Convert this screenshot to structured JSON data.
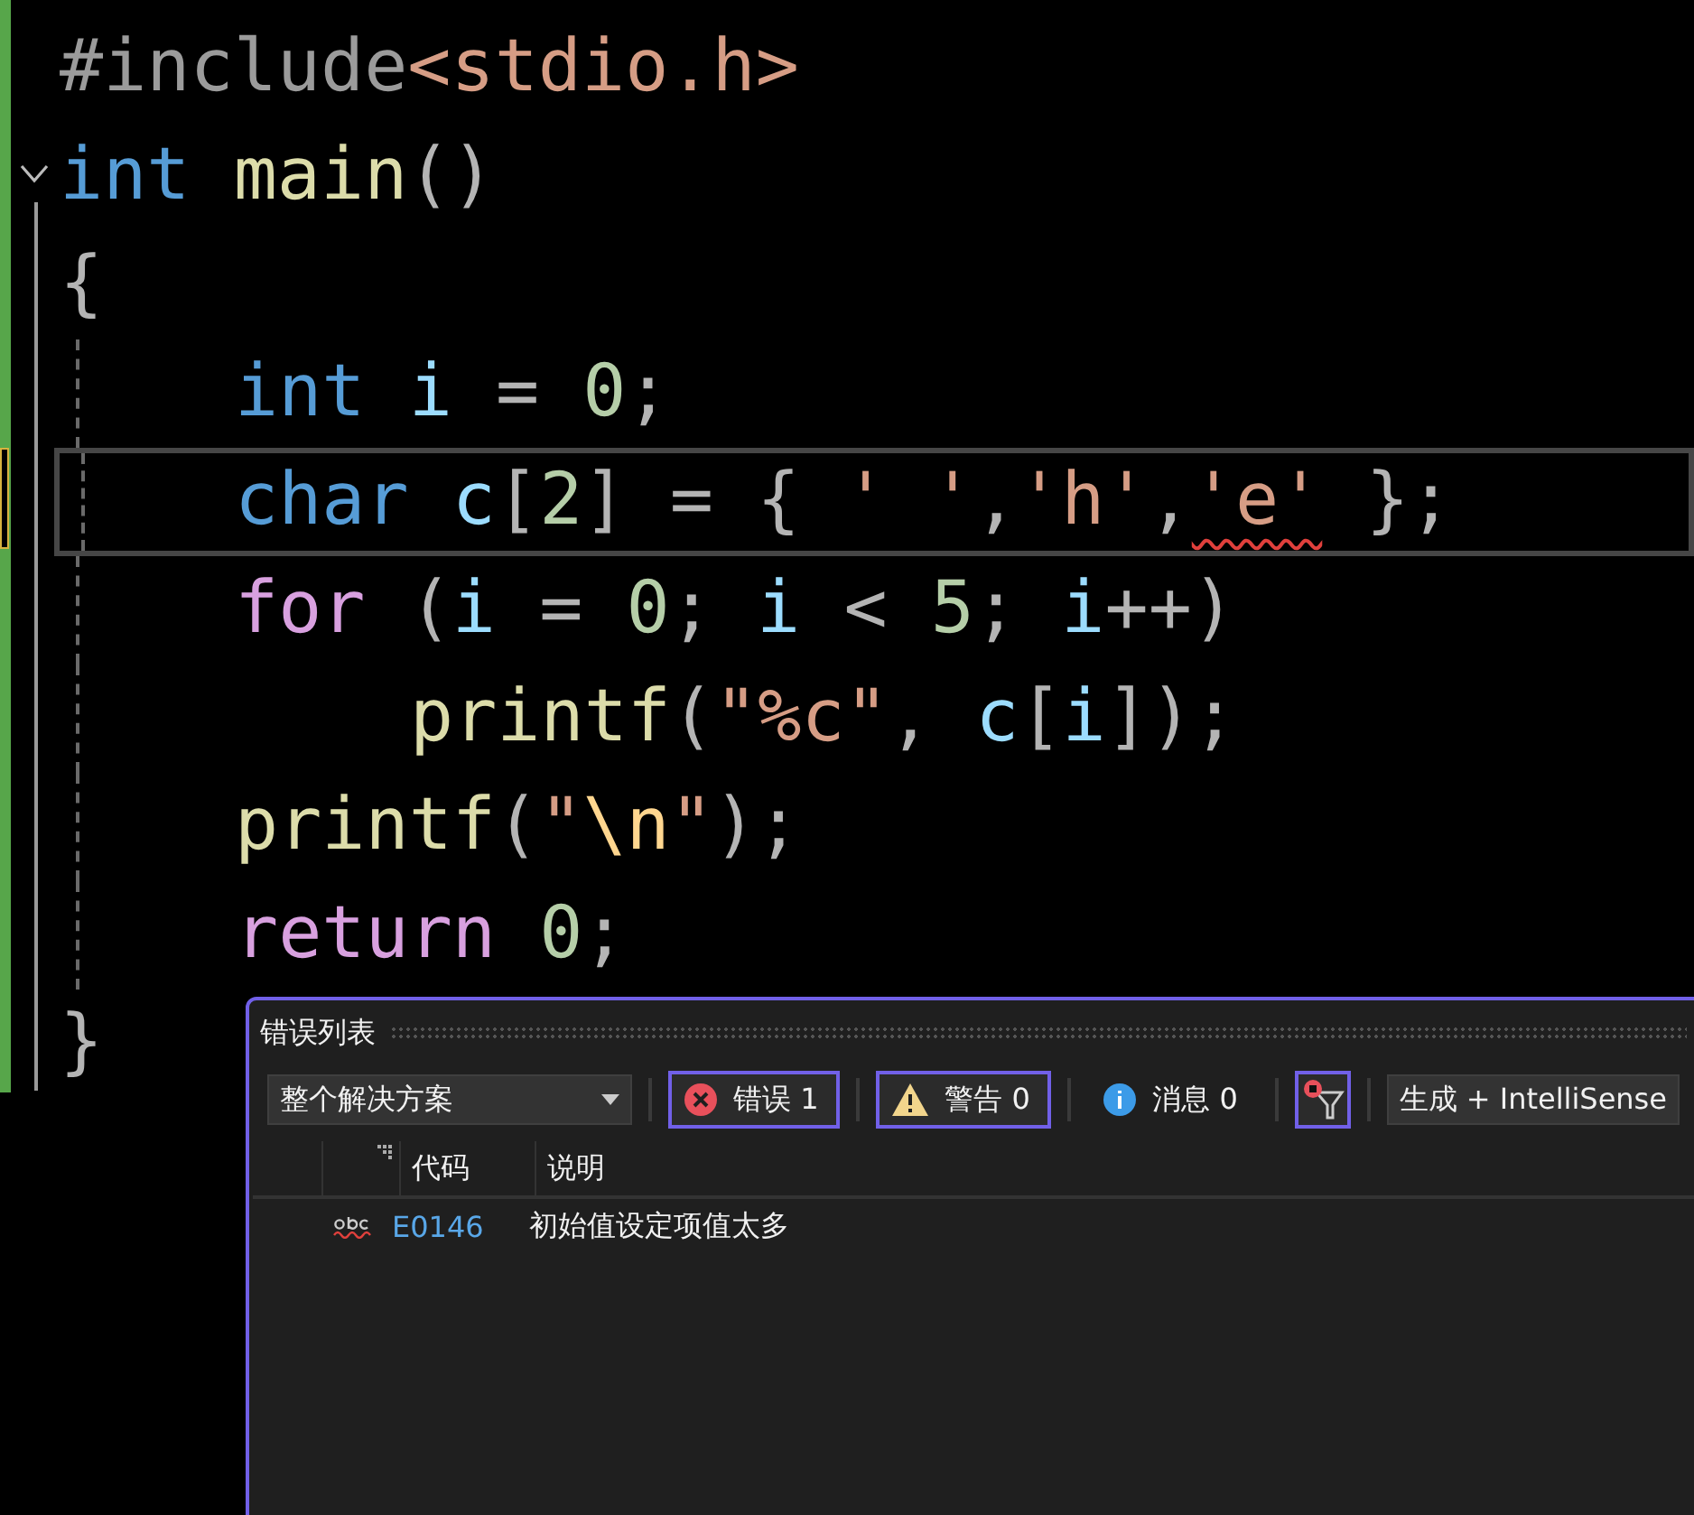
{
  "editor": {
    "lines": [
      {
        "tokens": [
          {
            "text": "#include",
            "kind": "preprocessor"
          },
          {
            "text": "<stdio.h>",
            "kind": "include_path"
          }
        ]
      },
      {
        "collapsible": true,
        "expanded": true,
        "tokens": [
          {
            "text": "int ",
            "kind": "keyword"
          },
          {
            "text": "main",
            "kind": "function"
          },
          {
            "text": "()",
            "kind": "punct"
          }
        ]
      },
      {
        "tokens": [
          {
            "text": "{",
            "kind": "punct"
          }
        ],
        "children": [
          {
            "tokens": [
              {
                "text": "int ",
                "kind": "keyword"
              },
              {
                "text": "i",
                "kind": "variable"
              },
              {
                "text": " = ",
                "kind": "punct"
              },
              {
                "text": "0",
                "kind": "number"
              },
              {
                "text": ";",
                "kind": "punct"
              }
            ]
          },
          {
            "current": true,
            "unsaved": true,
            "tokens": [
              {
                "text": "char ",
                "kind": "keyword"
              },
              {
                "text": "c",
                "kind": "variable"
              },
              {
                "text": "[",
                "kind": "punct"
              },
              {
                "text": "2",
                "kind": "number"
              },
              {
                "text": "] = { ",
                "kind": "punct"
              },
              {
                "text": "' '",
                "kind": "string"
              },
              {
                "text": ",",
                "kind": "punct"
              },
              {
                "text": "'h'",
                "kind": "string"
              },
              {
                "text": ",",
                "kind": "punct"
              },
              {
                "text": "'e'",
                "kind": "string",
                "error": true
              },
              {
                "text": " };",
                "kind": "punct"
              }
            ]
          },
          {
            "tokens": [
              {
                "text": "for ",
                "kind": "control"
              },
              {
                "text": "(",
                "kind": "punct"
              },
              {
                "text": "i",
                "kind": "variable"
              },
              {
                "text": " = ",
                "kind": "punct"
              },
              {
                "text": "0",
                "kind": "number"
              },
              {
                "text": "; ",
                "kind": "punct"
              },
              {
                "text": "i",
                "kind": "variable"
              },
              {
                "text": " < ",
                "kind": "punct"
              },
              {
                "text": "5",
                "kind": "number"
              },
              {
                "text": "; ",
                "kind": "punct"
              },
              {
                "text": "i",
                "kind": "variable"
              },
              {
                "text": "++)",
                "kind": "punct"
              }
            ],
            "children": [
              {
                "tokens": [
                  {
                    "text": "printf",
                    "kind": "function"
                  },
                  {
                    "text": "(",
                    "kind": "punct"
                  },
                  {
                    "text": "\"%c\"",
                    "kind": "string"
                  },
                  {
                    "text": ", ",
                    "kind": "punct"
                  },
                  {
                    "text": "c",
                    "kind": "variable"
                  },
                  {
                    "text": "[",
                    "kind": "punct"
                  },
                  {
                    "text": "i",
                    "kind": "variable"
                  },
                  {
                    "text": "]);",
                    "kind": "punct"
                  }
                ]
              }
            ]
          },
          {
            "tokens": [
              {
                "text": "printf",
                "kind": "function"
              },
              {
                "text": "(",
                "kind": "punct"
              },
              {
                "text": "\"",
                "kind": "string"
              },
              {
                "text": "\\n",
                "kind": "escape"
              },
              {
                "text": "\"",
                "kind": "string"
              },
              {
                "text": ");",
                "kind": "punct"
              }
            ]
          },
          {
            "tokens": [
              {
                "text": "return ",
                "kind": "control"
              },
              {
                "text": "0",
                "kind": "number"
              },
              {
                "text": ";",
                "kind": "punct"
              }
            ]
          }
        ]
      },
      {
        "tokens": [
          {
            "text": "}",
            "kind": "punct"
          }
        ]
      }
    ]
  },
  "error_list": {
    "title": "错误列表",
    "scope": "整个解决方案",
    "filters": [
      {
        "kind": "error",
        "label": "错误 1",
        "selected": true
      },
      {
        "kind": "warning",
        "label": "警告 0",
        "selected": true
      },
      {
        "kind": "info",
        "label": "消息 0",
        "selected": false
      }
    ],
    "filter_toggle": {
      "selected": true
    },
    "source": "生成 + IntelliSense",
    "columns": [
      "代码",
      "说明"
    ],
    "rows": [
      {
        "code": "E0146",
        "description": "初始值设定项值太多"
      }
    ]
  }
}
